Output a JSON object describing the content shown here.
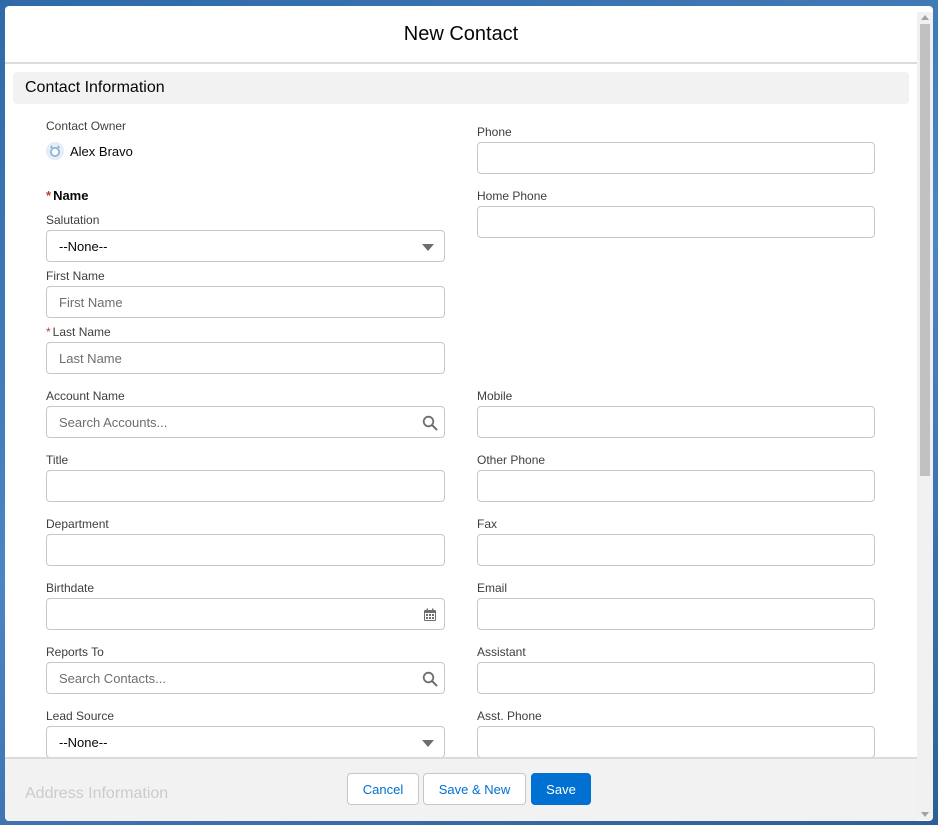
{
  "modal": {
    "title": "New Contact"
  },
  "section": {
    "title": "Contact Information"
  },
  "owner": {
    "label": "Contact Owner",
    "value": "Alex Bravo",
    "icon": "user-avatar-icon"
  },
  "name_group": {
    "required_mark": "*",
    "label": "Name"
  },
  "salutation": {
    "label": "Salutation",
    "value": "--None--"
  },
  "first_name": {
    "label": "First Name",
    "placeholder": "First Name"
  },
  "last_name": {
    "required_mark": "*",
    "label": "Last Name",
    "placeholder": "Last Name"
  },
  "account_name": {
    "label": "Account Name",
    "placeholder": "Search Accounts...",
    "icon": "search-icon"
  },
  "title_field": {
    "label": "Title"
  },
  "department": {
    "label": "Department"
  },
  "birthdate": {
    "label": "Birthdate",
    "icon": "calendar-icon"
  },
  "reports_to": {
    "label": "Reports To",
    "placeholder": "Search Contacts...",
    "icon": "search-icon"
  },
  "lead_source": {
    "label": "Lead Source",
    "value": "--None--"
  },
  "phone": {
    "label": "Phone"
  },
  "home_phone": {
    "label": "Home Phone"
  },
  "mobile": {
    "label": "Mobile"
  },
  "other_phone": {
    "label": "Other Phone"
  },
  "fax": {
    "label": "Fax"
  },
  "email": {
    "label": "Email"
  },
  "assistant": {
    "label": "Assistant"
  },
  "asst_phone": {
    "label": "Asst. Phone"
  },
  "footer": {
    "next_section": "Address Information",
    "cancel_label": "Cancel",
    "save_new_label": "Save & New",
    "save_label": "Save"
  },
  "colors": {
    "brand": "#0070d2",
    "required": "#c23934",
    "section_bg": "#f3f2f2"
  }
}
